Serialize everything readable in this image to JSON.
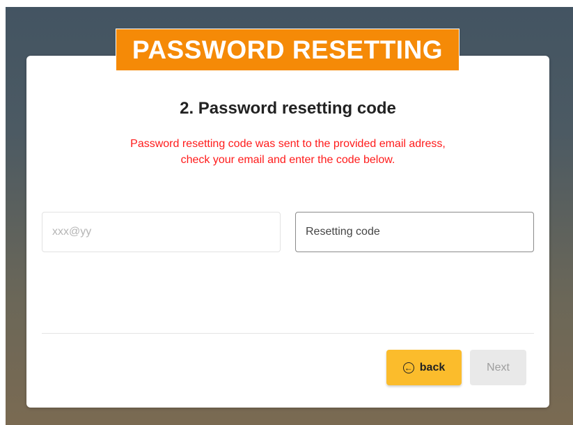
{
  "banner": {
    "title": "PASSWORD RESETTING"
  },
  "step": {
    "title": "2. Password resetting code"
  },
  "notice": {
    "line1": "Password resetting code was sent to the provided email adress,",
    "line2": "check your email and enter the code below."
  },
  "form": {
    "email_placeholder": "xxx@yy",
    "code_placeholder": "Resetting code"
  },
  "actions": {
    "back_label": "back",
    "next_label": "Next"
  },
  "icons": {
    "back": "arrow-left-circle-icon"
  },
  "colors": {
    "banner": "#f58a07",
    "notice": "#ff1a1a",
    "back_button": "#fbbc2c",
    "next_button_disabled": "#e9e9e9"
  }
}
